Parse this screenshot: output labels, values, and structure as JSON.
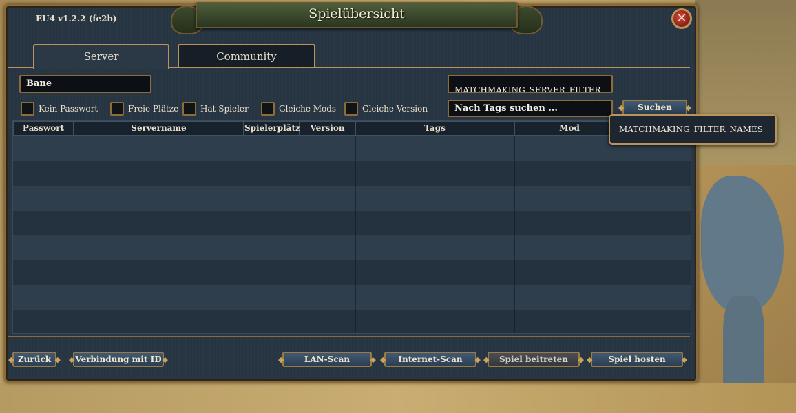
{
  "app": {
    "version": "EU4 v1.2.2 (fe2b)",
    "title": "Spielübersicht",
    "close_symbol": "✕"
  },
  "tabs": [
    {
      "label": "Server"
    },
    {
      "label": "Community"
    }
  ],
  "search": {
    "value": "Bane"
  },
  "filter_box": {
    "text": "MATCHMAKING_SERVER_FILTER"
  },
  "tag_search": {
    "placeholder": "Nach Tags suchen ..."
  },
  "search_button": {
    "label": "Suchen"
  },
  "checkboxes": [
    {
      "label": "Kein Passwort"
    },
    {
      "label": "Freie Plätze"
    },
    {
      "label": "Hat Spieler"
    },
    {
      "label": "Gleiche Mods"
    },
    {
      "label": "Gleiche Version"
    }
  ],
  "table": {
    "columns": [
      "Passwort",
      "Servername",
      "Spielerplätze",
      "Version",
      "Tags",
      "Mod"
    ]
  },
  "tooltip": {
    "text": "MATCHMAKING_FILTER_NAMES"
  },
  "footer": {
    "back": "Zurück",
    "connect_id": "Verbindung mit ID",
    "lan_scan": "LAN-Scan",
    "internet_scan": "Internet-Scan",
    "join": "Spiel beitreten",
    "host": "Spiel hosten"
  },
  "colors": {
    "panel": "#273441",
    "border_gold": "#b8945a",
    "title_ribbon": "#4e5e3a",
    "close": "#c23b2e"
  }
}
